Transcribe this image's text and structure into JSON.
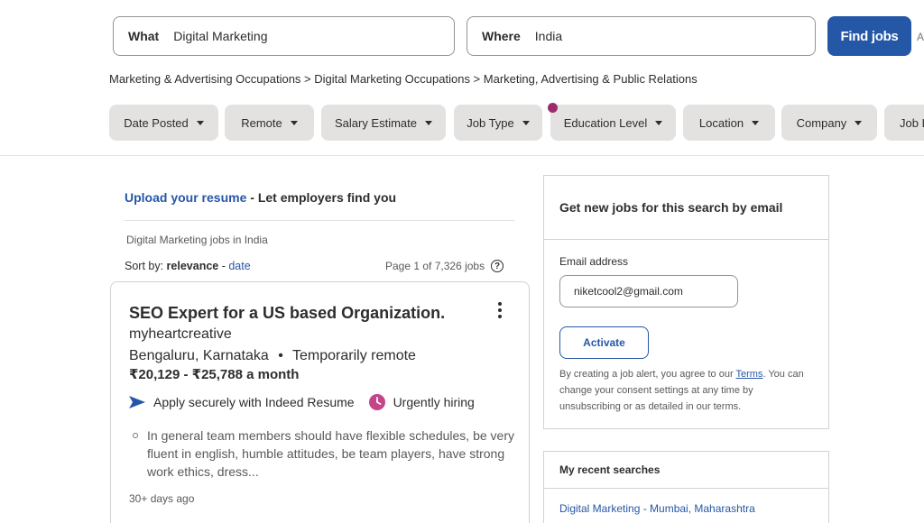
{
  "search": {
    "what_label": "What",
    "what_value": "Digital Marketing",
    "where_label": "Where",
    "where_value": "India",
    "find_jobs_label": "Find jobs",
    "advanced_partial": "A"
  },
  "breadcrumb": "Marketing & Advertising Occupations > Digital Marketing Occupations > Marketing, Advertising & Public Relations",
  "filters": [
    "Date Posted",
    "Remote",
    "Salary Estimate",
    "Job Type",
    "Education Level",
    "Location",
    "Company",
    "Job L"
  ],
  "results": {
    "upload_link": "Upload your resume",
    "upload_rest": " - Let employers find you",
    "subtitle": "Digital Marketing jobs in India",
    "sort_prefix": "Sort by: ",
    "sort_active": "relevance",
    "sort_sep": " - ",
    "sort_other": "date",
    "page_count": "Page 1 of 7,326 jobs",
    "help_icon": "?"
  },
  "job": {
    "title": "SEO Expert for a US based Organization.",
    "company": "myheartcreative",
    "location": "Bengaluru, Karnataka",
    "separator": "•",
    "remote": "Temporarily remote",
    "salary": "₹20,129 - ₹25,788 a month",
    "apply_text": "Apply securely with Indeed Resume",
    "urgent_text": "Urgently hiring",
    "snippet": "In general team members should have flexible schedules, be very fluent in english, humble attitudes, be team players, have strong work ethics, dress...",
    "posted": "30+ days ago"
  },
  "alert": {
    "title": "Get new jobs for this search by email",
    "email_label": "Email address",
    "email_value": "niketcool2@gmail.com",
    "activate_label": "Activate",
    "disclaimer_pre": "By creating a job alert, you agree to our ",
    "terms_link": "Terms",
    "disclaimer_post": ". You can change your consent settings at any time by unsubscribing or as detailed in our terms."
  },
  "recent": {
    "title": "My recent searches",
    "item": "Digital Marketing - Mumbai, Maharashtra"
  },
  "colors": {
    "brand_blue": "#2557a7",
    "urgent_pink": "#c4458a",
    "filter_bg": "#e4e2e0"
  }
}
